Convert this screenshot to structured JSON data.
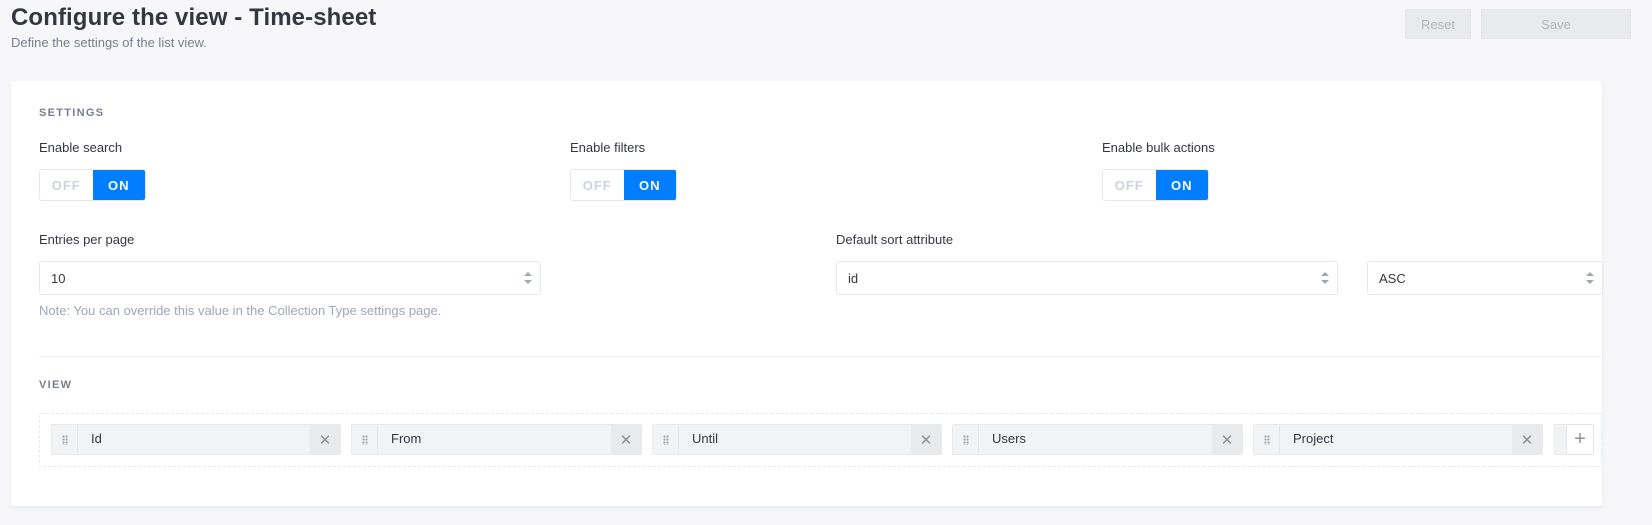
{
  "header": {
    "title": "Configure the view - Time-sheet",
    "subtitle": "Define the settings of the list view.",
    "reset_label": "Reset",
    "save_label": "Save"
  },
  "settings": {
    "section_title": "SETTINGS",
    "toggles": [
      {
        "label": "Enable search",
        "off": "OFF",
        "on": "ON",
        "value": "ON"
      },
      {
        "label": "Enable filters",
        "off": "OFF",
        "on": "ON",
        "value": "ON"
      },
      {
        "label": "Enable bulk actions",
        "off": "OFF",
        "on": "ON",
        "value": "ON"
      }
    ],
    "entries_per_page": {
      "label": "Entries per page",
      "value": "10",
      "note": "Note: You can override this value in the Collection Type settings page."
    },
    "default_sort": {
      "label": "Default sort attribute",
      "attribute": "id",
      "order": "ASC"
    }
  },
  "view": {
    "section_title": "VIEW",
    "fields": [
      "Id",
      "From",
      "Until",
      "Users",
      "Project"
    ],
    "add_label": "+"
  },
  "colors": {
    "accent": "#007eff",
    "background": "#f7f7f9"
  }
}
